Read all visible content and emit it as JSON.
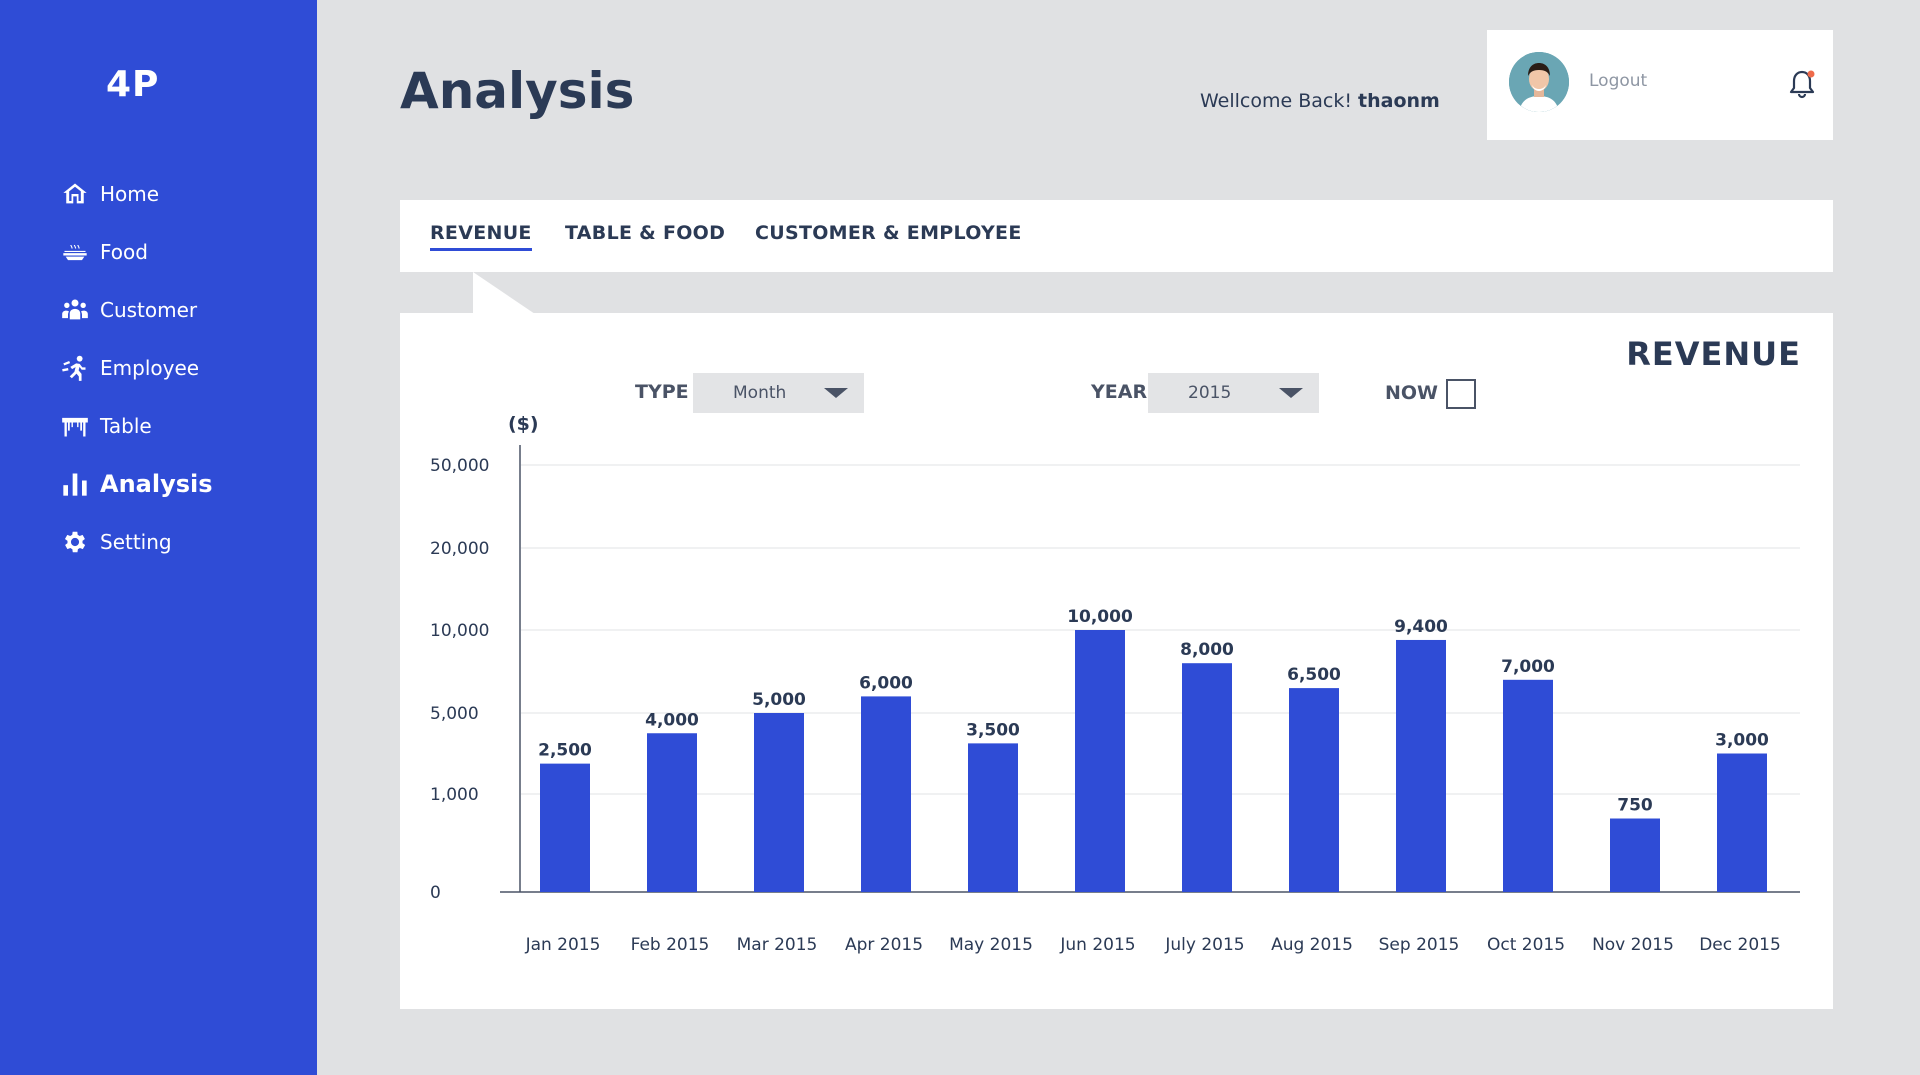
{
  "app": {
    "logo": "4P"
  },
  "sidebar": {
    "items": [
      {
        "label": "Home",
        "icon": "home-icon"
      },
      {
        "label": "Food",
        "icon": "food-icon"
      },
      {
        "label": "Customer",
        "icon": "customer-icon"
      },
      {
        "label": "Employee",
        "icon": "employee-icon"
      },
      {
        "label": "Table",
        "icon": "table-icon"
      },
      {
        "label": "Analysis",
        "icon": "analysis-icon",
        "active": true
      },
      {
        "label": "Setting",
        "icon": "gear-icon"
      }
    ]
  },
  "header": {
    "title": "Analysis",
    "welcome_text": "Wellcome Back!",
    "username": "thaonm",
    "logout_label": "Logout"
  },
  "tabs": [
    {
      "label": "REVENUE",
      "active": true
    },
    {
      "label": "TABLE & FOOD"
    },
    {
      "label": "CUSTOMER & EMPLOYEE"
    }
  ],
  "panel": {
    "title": "REVENUE",
    "type_label": "TYPE",
    "type_value": "Month",
    "year_label": "YEAR",
    "year_value": "2015",
    "now_label": "NOW",
    "now_checked": false
  },
  "colors": {
    "sidebar": "#2f4cd6",
    "bar": "#2f4cd6",
    "text": "#2b3a55",
    "background": "#e0e1e3"
  },
  "chart_data": {
    "type": "bar",
    "ylabel": "($)",
    "categories": [
      "Jan 2015",
      "Feb 2015",
      "Mar 2015",
      "Apr 2015",
      "May 2015",
      "Jun 2015",
      "July 2015",
      "Aug 2015",
      "Sep 2015",
      "Oct 2015",
      "Nov 2015",
      "Dec 2015"
    ],
    "values": [
      2500,
      4000,
      5000,
      6000,
      3500,
      10000,
      8000,
      6500,
      9400,
      7000,
      750,
      3000
    ],
    "value_labels": [
      "2,500",
      "4,000",
      "5,000",
      "6,000",
      "3,500",
      "10,000",
      "8,000",
      "6,500",
      "9,400",
      "7,000",
      "750",
      "3,000"
    ],
    "y_ticks": [
      0,
      1000,
      5000,
      10000,
      20000,
      50000
    ],
    "y_tick_labels": [
      "0",
      "1,000",
      "5,000",
      "10,000",
      "20,000",
      "50,000"
    ],
    "y_scale": "piecewise (non-linear tick spacing)",
    "grid": true
  }
}
